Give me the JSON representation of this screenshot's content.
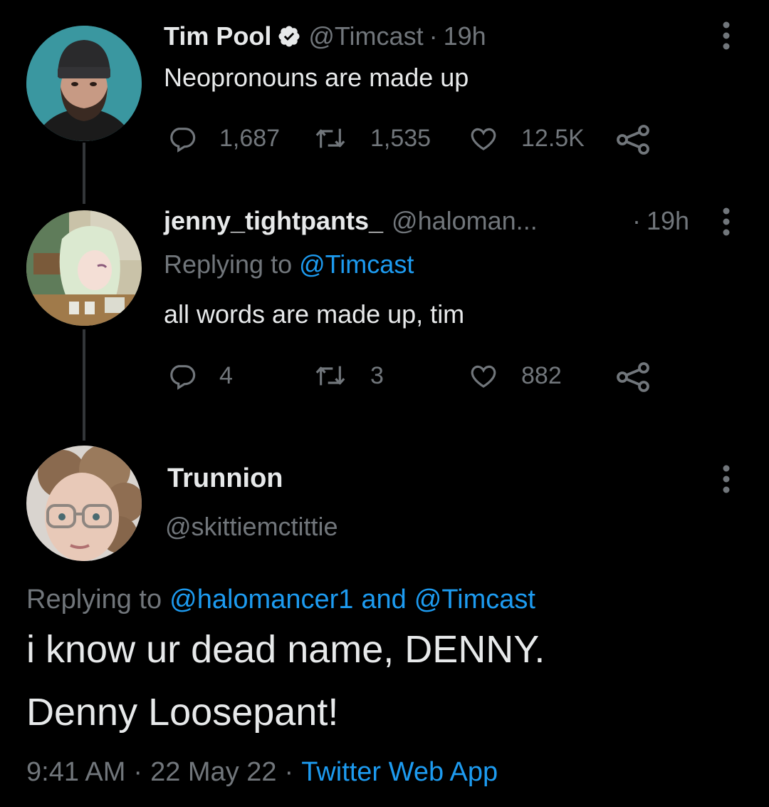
{
  "tweets": [
    {
      "display_name": "Tim Pool",
      "verified": true,
      "handle": "@Timcast",
      "separator": "·",
      "time": "19h",
      "text": "Neopronouns are made up",
      "replies": "1,687",
      "retweets": "1,535",
      "likes": "12.5K"
    },
    {
      "display_name": "jenny_tightpants_",
      "handle": "@haloman...",
      "separator": "·",
      "time": "19h",
      "replying_label": "Replying to",
      "replying_to": "@Timcast",
      "text": "all words are made up, tim",
      "replies": "4",
      "retweets": "3",
      "likes": "882"
    }
  ],
  "main_tweet": {
    "display_name": "Trunnion",
    "handle": "@skittiemctittie",
    "replying_label": "Replying to",
    "replying_to_1": "@halomancer1",
    "replying_and": "and",
    "replying_to_2": "@Timcast",
    "text_line1": "i know ur dead name, DENNY.",
    "text_line2": "Denny Loosepant!",
    "time": "9:41 AM",
    "date": "22 May 22",
    "separator": "·",
    "source": "Twitter Web App"
  },
  "icons": [
    "verified-badge-icon",
    "reply-icon",
    "retweet-icon",
    "like-icon",
    "share-icon",
    "more-options-icon"
  ],
  "colors": {
    "background": "#000000",
    "text": "#e7e9ea",
    "muted": "#71767b",
    "link": "#1d9bf0",
    "thread_line": "#333639"
  }
}
